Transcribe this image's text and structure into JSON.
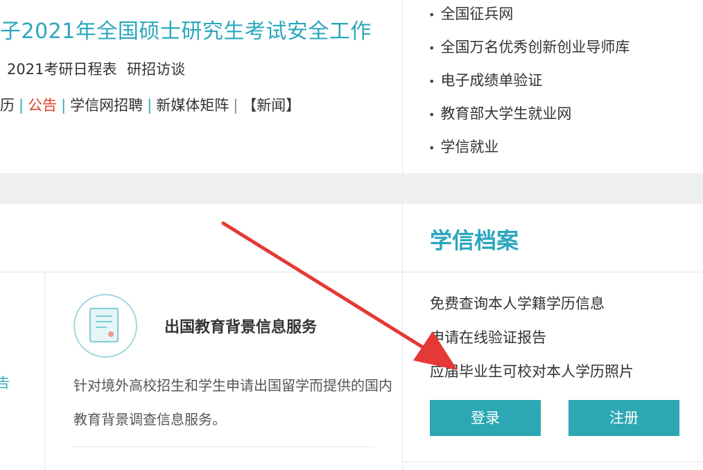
{
  "news": {
    "headline": "子2021年全国硕士研究生考试安全工作",
    "sub_links": [
      "2021考研日程表",
      "研招访谈"
    ],
    "link_row_prefix": "历",
    "link_row": [
      {
        "label": "公告",
        "highlight": true
      },
      {
        "label": "学信网招聘",
        "highlight": false
      },
      {
        "label": "新媒体矩阵",
        "highlight": false
      },
      {
        "label": "【新闻】",
        "highlight": false
      }
    ]
  },
  "right_list": [
    "全国征兵网",
    "全国万名优秀创新创业导师库",
    "电子成绩单验证",
    "教育部大学生就业网",
    "学信就业"
  ],
  "archive": {
    "title": "学信档案",
    "links": [
      "免费查询本人学籍学历信息",
      "申请在线验证报告",
      "应届毕业生可校对本人学历照片"
    ],
    "login": "登录",
    "register": "注册"
  },
  "service": {
    "title": "出国教育背景信息服务",
    "desc": "针对境外高校招生和学生申请出国留学而提供的国内教育背景调查信息服务。",
    "left_edge_char": "告"
  },
  "colors": {
    "accent": "#2aa7bc",
    "button": "#2ba8b3",
    "highlight": "#e0412a",
    "arrow": "#e53935"
  }
}
